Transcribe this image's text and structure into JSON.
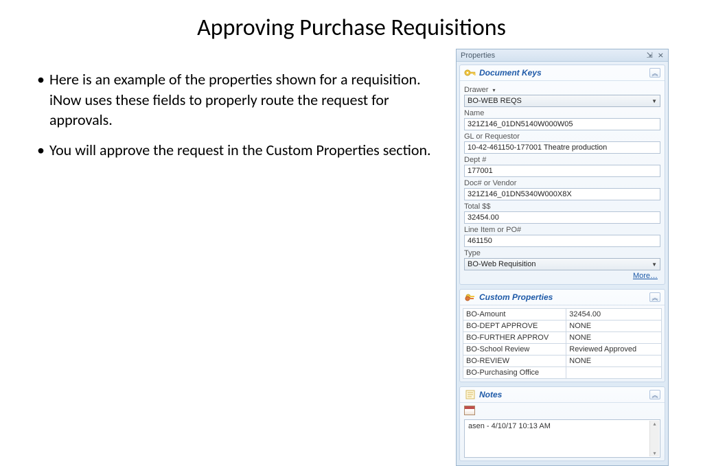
{
  "title": "Approving Purchase Requisitions",
  "bullets": [
    "Here is an example of the properties shown for a requisition. iNow uses these fields to properly route the request for approvals.",
    "You will approve the request in the Custom Properties section."
  ],
  "panel": {
    "title": "Properties",
    "doc_keys": {
      "header": "Document Keys",
      "drawer_label": "Drawer",
      "drawer_value": "BO-WEB REQS",
      "name_label": "Name",
      "name_value": "321Z146_01DN5140W000W05",
      "gl_label": "GL or Requestor",
      "gl_value": "10-42-461150-177001 Theatre production",
      "dept_label": "Dept #",
      "dept_value": "177001",
      "doc_label": "Doc# or Vendor",
      "doc_value": "321Z146_01DN5340W000X8X",
      "total_label": "Total $$",
      "total_value": "32454.00",
      "line_label": "Line Item or PO#",
      "line_value": "461150",
      "type_label": "Type",
      "type_value": "BO-Web Requisition",
      "more": "More…"
    },
    "custom": {
      "header": "Custom Properties",
      "rows": [
        {
          "k": "BO-Amount",
          "v": "32454.00"
        },
        {
          "k": "BO-DEPT APPROVE",
          "v": "NONE"
        },
        {
          "k": "BO-FURTHER APPROV",
          "v": "NONE"
        },
        {
          "k": "BO-School Review",
          "v": "Reviewed Approved"
        },
        {
          "k": "BO-REVIEW",
          "v": "NONE"
        },
        {
          "k": "BO-Purchasing Office",
          "v": ""
        }
      ]
    },
    "notes": {
      "header": "Notes",
      "entry": "asen  - 4/10/17 10:13 AM"
    }
  }
}
